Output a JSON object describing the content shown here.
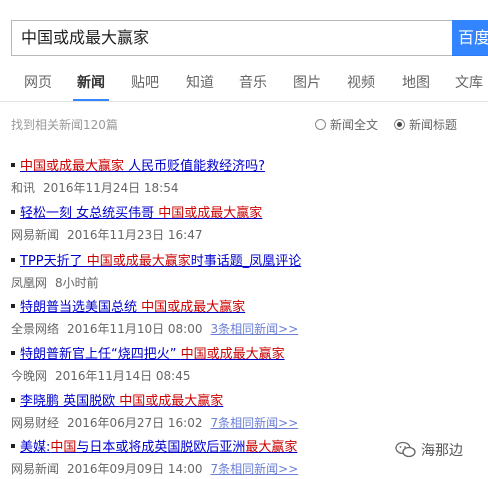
{
  "search": {
    "query": "中国或成最大赢家",
    "button_label": "百度"
  },
  "tabs": [
    {
      "label": "网页"
    },
    {
      "label": "新闻"
    },
    {
      "label": "贴吧"
    },
    {
      "label": "知道"
    },
    {
      "label": "音乐"
    },
    {
      "label": "图片"
    },
    {
      "label": "视频"
    },
    {
      "label": "地图"
    },
    {
      "label": "文库"
    }
  ],
  "result_count": "找到相关新闻120篇",
  "filters": {
    "full_text": "新闻全文",
    "title_only": "新闻标题",
    "selected": "新闻标题"
  },
  "news": [
    {
      "pre": "",
      "hl": "中国或成最大赢家",
      "post": " 人民币贬值能救经济吗?",
      "source": "和讯",
      "time": "2016年11月24日 18:54",
      "related": ""
    },
    {
      "pre": "轻松一刻 女总统买伟哥 ",
      "hl": "中国或成最大赢家",
      "post": "",
      "source": "网易新闻",
      "time": "2016年11月23日 16:47",
      "related": ""
    },
    {
      "pre": "TPP天折了 ",
      "hl": "中国或成最大赢家",
      "post": "时事话题_凤凰评论",
      "source": "凤凰网",
      "time": "8小时前",
      "related": ""
    },
    {
      "pre": "特朗普当选美国总统 ",
      "hl": "中国或成最大赢家",
      "post": "",
      "source": "全景网络",
      "time": "2016年11月10日 08:00",
      "related": "3条相同新闻>>"
    },
    {
      "pre": "特朗普新官上任“烧四把火” ",
      "hl": "中国或成最大赢家",
      "post": "",
      "source": "今晚网",
      "time": "2016年11月14日 08:45",
      "related": ""
    },
    {
      "pre": "李晓鹏 英国脱欧 ",
      "hl": "中国或成最大赢家",
      "post": "",
      "source": "网易财经",
      "time": "2016年06月27日 16:02",
      "related": "7条相同新闻>>"
    },
    {
      "pre": "美媒:",
      "hl": "中国",
      "post": "与日本或将成英国脱欧后亚洲",
      "hl2": "最大赢家",
      "source": "网易新闻",
      "time": "2016年09月09日 14:00",
      "related": "7条相同新闻>>"
    }
  ],
  "watermark": "海那边",
  "colors": {
    "link": "#0000cc",
    "highlight": "#cc0000",
    "accent": "#3385ff"
  }
}
